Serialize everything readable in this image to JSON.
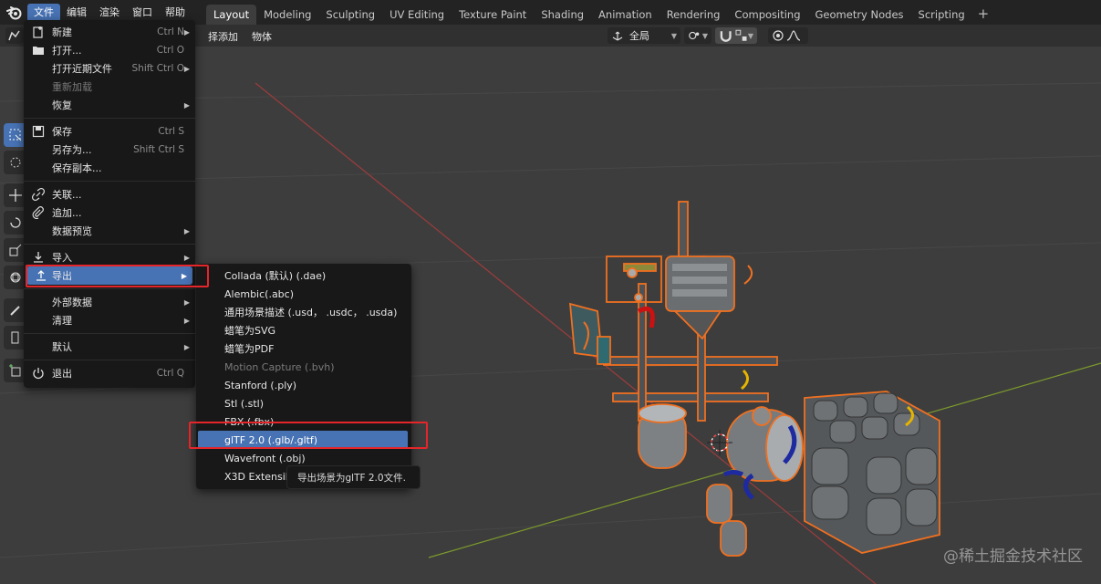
{
  "main_menu": [
    "文件",
    "编辑",
    "渲染",
    "窗口",
    "帮助"
  ],
  "workspaces": [
    "Layout",
    "Modeling",
    "Sculpting",
    "UV Editing",
    "Texture Paint",
    "Shading",
    "Animation",
    "Rendering",
    "Compositing",
    "Geometry Nodes",
    "Scripting"
  ],
  "workspace_add": "+",
  "viewport_header": {
    "select_partial": "择",
    "add": "添加",
    "object": "物体",
    "pivot_value": "全局"
  },
  "file_menu": {
    "new": "新建",
    "new_sc": "Ctrl N",
    "open": "打开...",
    "open_sc": "Ctrl O",
    "open_recent": "打开近期文件",
    "open_recent_sc": "Shift Ctrl O",
    "revert": "重新加载",
    "recover": "恢复",
    "save": "保存",
    "save_sc": "Ctrl S",
    "save_as": "另存为...",
    "save_as_sc": "Shift Ctrl S",
    "save_copy": "保存副本...",
    "link": "关联...",
    "append": "追加...",
    "data_previews": "数据预览",
    "import": "导入",
    "export": "导出",
    "external_data": "外部数据",
    "clean_up": "清理",
    "defaults": "默认",
    "quit": "退出",
    "quit_sc": "Ctrl Q"
  },
  "export_menu": [
    "Collada (默认) (.dae)",
    "Alembic(.abc)",
    "通用场景描述 (.usd， .usdc， .usda)",
    "蜡笔为SVG",
    "蜡笔为PDF",
    "Motion Capture (.bvh)",
    "Stanford (.ply)",
    "Stl (.stl)",
    "FBX (.fbx)",
    "glTF 2.0 (.glb/.gltf)",
    "Wavefront (.obj)",
    "X3D Extensib"
  ],
  "tooltip": "导出场景为glTF 2.0文件.",
  "watermark": "@稀土掘金技术社区",
  "colors": {
    "accent": "#4772b3",
    "highlight_box": "#e5252a",
    "selection_outline": "#f07020"
  }
}
